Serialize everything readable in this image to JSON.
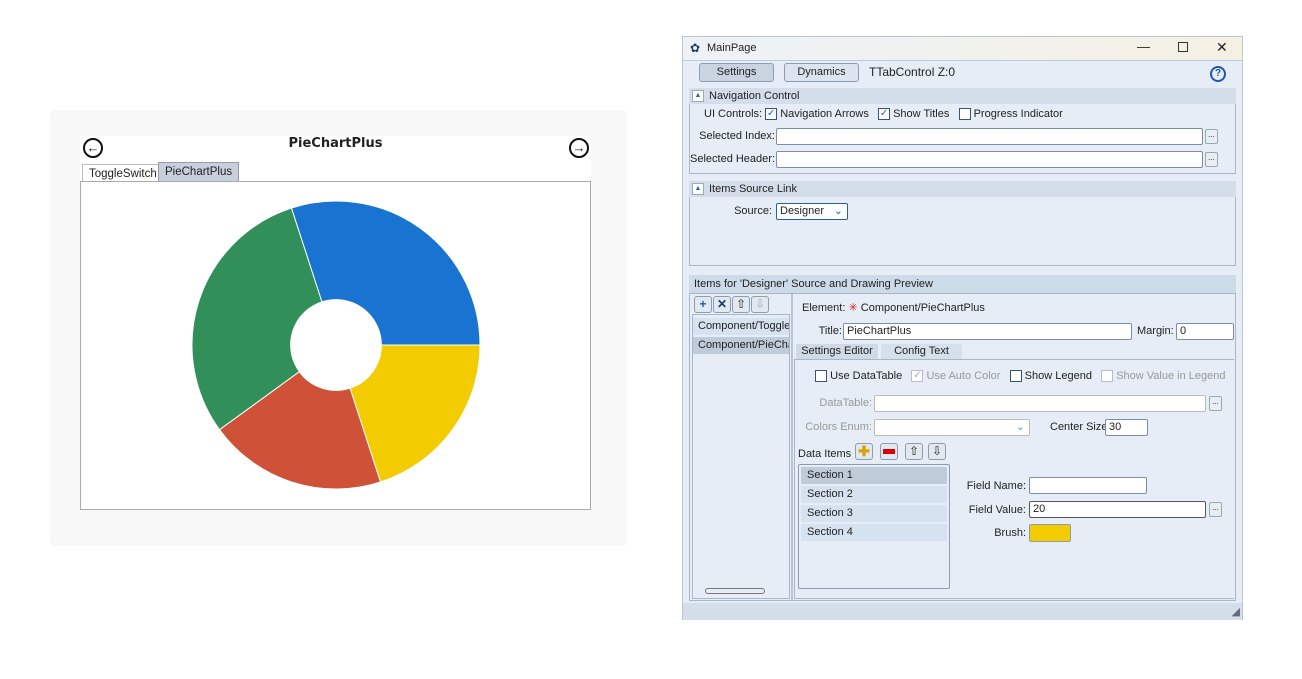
{
  "preview": {
    "title": "PieChartPlus",
    "tabs": [
      {
        "label": "ToggleSwitch",
        "active": false
      },
      {
        "label": "PieChartPlus",
        "active": true
      }
    ],
    "icons": {
      "back": "arrow-left-circle-icon",
      "forward": "arrow-right-circle-icon"
    }
  },
  "chart_data": {
    "type": "pie",
    "donut": true,
    "center_size": 30,
    "start_angle_deg": 90,
    "direction": "clockwise",
    "categories": [
      "Section 1",
      "Section 2",
      "Section 3",
      "Section 4"
    ],
    "values": [
      20,
      20,
      30,
      30
    ],
    "colors": [
      "#f2cc00",
      "#cf5238",
      "#318f5a",
      "#1874d0"
    ],
    "legend": false
  },
  "window": {
    "title": "MainPage",
    "tabs": {
      "settings": "Settings",
      "dynamics": "Dynamics"
    },
    "control_label": "TTabControl Z:0",
    "help": "?",
    "nav_section": {
      "header": "Navigation Control",
      "ui_controls_label": "UI Controls:",
      "checks": [
        {
          "label": "Navigation Arrows",
          "checked": true
        },
        {
          "label": "Show Titles",
          "checked": true
        },
        {
          "label": "Progress Indicator",
          "checked": false
        }
      ],
      "selected_index_label": "Selected Index:",
      "selected_index": "",
      "selected_header_label": "Selected Header:",
      "selected_header": "",
      "dots": "..."
    },
    "items_source": {
      "header": "Items Source Link",
      "source_label": "Source:",
      "source_value": "Designer"
    },
    "items_section": {
      "header": "Items for 'Designer' Source and Drawing Preview",
      "list": [
        "Component/ToggleSwitch",
        "Component/PieChartPlus"
      ],
      "selected_index": 1,
      "element_label": "Element:",
      "element_value": "Component/PieChartPlus",
      "title_label": "Title:",
      "title_value": "PieChartPlus",
      "margin_label": "Margin:",
      "margin_value": "0",
      "subtabs": [
        "Settings Editor",
        "Config Text"
      ],
      "checks": [
        {
          "label": "Use DataTable",
          "checked": false,
          "enabled": true
        },
        {
          "label": "Use Auto Color",
          "checked": true,
          "enabled": false
        },
        {
          "label": "Show Legend",
          "checked": false,
          "enabled": true
        },
        {
          "label": "Show Value in Legend",
          "checked": false,
          "enabled": false
        }
      ],
      "datatable_label": "DataTable:",
      "datatable_value": "",
      "colors_enum_label": "Colors Enum:",
      "colors_enum_value": "",
      "center_size_label": "Center Size:",
      "center_size_value": "30",
      "data_items_label": "Data Items",
      "data_items": [
        "Section 1",
        "Section 2",
        "Section 3",
        "Section 4"
      ],
      "selected_data_item": 0,
      "field_name_label": "Field Name:",
      "field_name_value": "",
      "field_value_label": "Field Value:",
      "field_value": "20",
      "brush_label": "Brush:",
      "brush_color": "#f2cc00"
    }
  }
}
